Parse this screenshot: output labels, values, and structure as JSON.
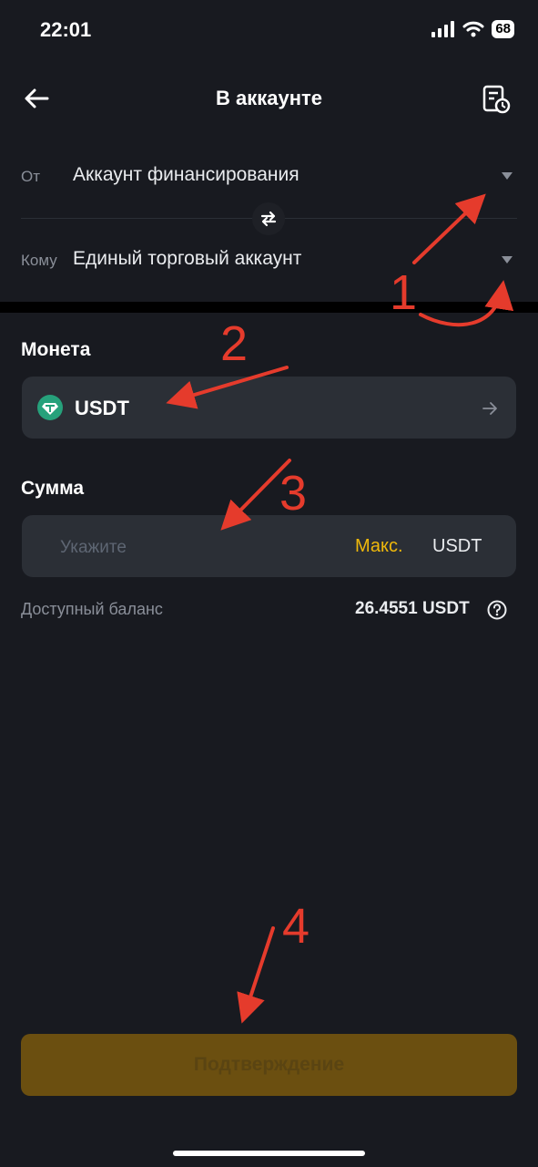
{
  "status_bar": {
    "time": "22:01",
    "battery": "68"
  },
  "header": {
    "title": "В аккаунте"
  },
  "transfer": {
    "from_label": "От",
    "from_account": "Аккаунт финансирования",
    "to_label": "Кому",
    "to_account": "Единый торговый аккаунт"
  },
  "coin": {
    "section_label": "Монета",
    "name": "USDT",
    "icon": "tether-icon"
  },
  "amount": {
    "section_label": "Сумма",
    "placeholder": "Укажите",
    "max_label": "Макс.",
    "unit": "USDT"
  },
  "balance": {
    "label": "Доступный баланс",
    "value": "26.4551 USDT"
  },
  "confirm_button": {
    "label": "Подтверждение"
  },
  "annotations": {
    "n1": "1",
    "n2": "2",
    "n3": "3",
    "n4": "4"
  },
  "colors": {
    "accent": "#f0b90b",
    "annotation": "#e53b2c",
    "background": "#181a20"
  }
}
